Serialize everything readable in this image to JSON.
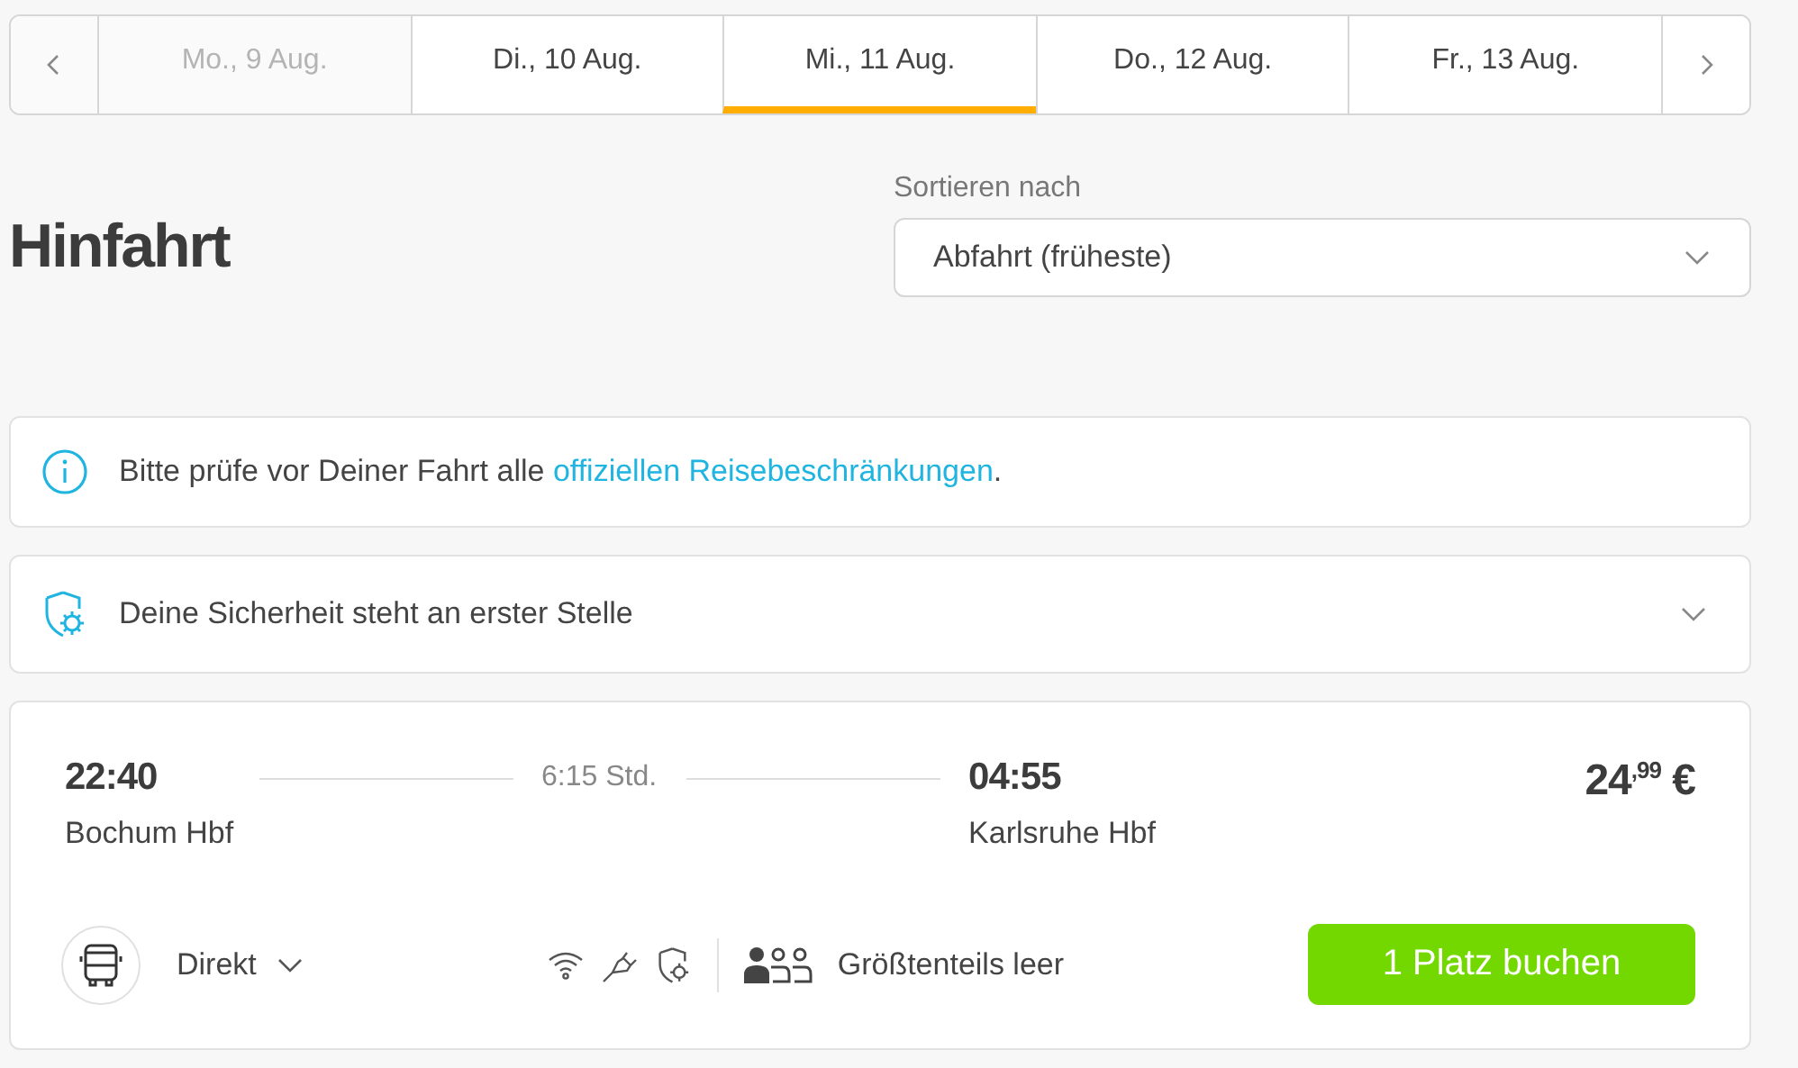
{
  "date_tabs": [
    {
      "label": "Mo., 9 Aug.",
      "selected": false,
      "disabled": true
    },
    {
      "label": "Di., 10 Aug.",
      "selected": false,
      "disabled": false
    },
    {
      "label": "Mi., 11 Aug.",
      "selected": true,
      "disabled": false
    },
    {
      "label": "Do., 12 Aug.",
      "selected": false,
      "disabled": false
    },
    {
      "label": "Fr., 13 Aug.",
      "selected": false,
      "disabled": false
    }
  ],
  "heading": "Hinfahrt",
  "sort": {
    "label": "Sortieren nach",
    "value": "Abfahrt (früheste)"
  },
  "notices": [
    {
      "kind": "info",
      "text": "Bitte prüfe vor Deiner Fahrt alle ",
      "link": "offiziellen Reisebeschränkungen",
      "after": "."
    },
    {
      "kind": "safety",
      "text": "Deine Sicherheit steht an erster Stelle",
      "expanded": false
    }
  ],
  "trip": {
    "departure_time": "22:40",
    "departure_station": "Bochum Hbf",
    "duration": "6:15 Std.",
    "arrival_time": "04:55",
    "arrival_station": "Karlsruhe Hbf",
    "price": "24$^{,99}$ €",
    "connection": "Direkt",
    "occupancy": "Größtenteils leer",
    "book_button": "1 Platz buchen"
  }
}
